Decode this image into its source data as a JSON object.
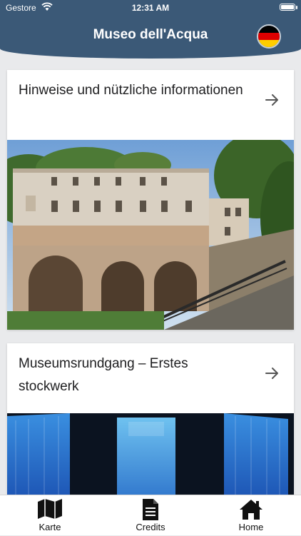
{
  "status_bar": {
    "carrier": "Gestore",
    "time": "12:31 AM"
  },
  "header": {
    "title": "Museo dell'Acqua",
    "language_flag": "german-flag-icon"
  },
  "cards": [
    {
      "title": "Hinweise und nützliche informationen",
      "image": "museum-building-photo"
    },
    {
      "title": "Museumsrundgang – Erstes stockwerk",
      "image": "exhibition-room-photo"
    }
  ],
  "tabs": [
    {
      "label": "Karte",
      "icon": "map-icon"
    },
    {
      "label": "Credits",
      "icon": "document-icon"
    },
    {
      "label": "Home",
      "icon": "home-icon"
    }
  ],
  "colors": {
    "nav": "#3b5977",
    "flag_black": "#000000",
    "flag_red": "#dd0000",
    "flag_gold": "#ffce00"
  }
}
